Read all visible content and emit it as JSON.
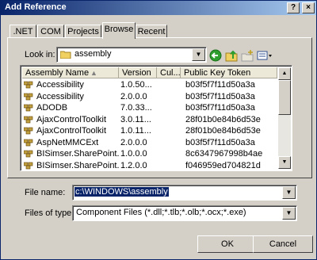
{
  "window": {
    "title": "Add Reference",
    "help_glyph": "?",
    "close_glyph": "×"
  },
  "tabs": [
    {
      "label": ".NET"
    },
    {
      "label": "COM"
    },
    {
      "label": "Projects"
    },
    {
      "label": "Browse"
    },
    {
      "label": "Recent"
    }
  ],
  "browse": {
    "look_in_label": "Look in:",
    "look_in_value": "assembly",
    "toolbar_icons": [
      "back-icon",
      "up-folder-icon",
      "new-folder-icon",
      "views-menu-icon"
    ]
  },
  "list": {
    "columns": [
      "Assembly Name",
      "Version",
      "Cul...",
      "Public Key Token"
    ],
    "rows": [
      {
        "name": "Accessibility",
        "version": "1.0.50...",
        "culture": "",
        "token": "b03f5f7f11d50a3a"
      },
      {
        "name": "Accessibility",
        "version": "2.0.0.0",
        "culture": "",
        "token": "b03f5f7f11d50a3a"
      },
      {
        "name": "ADODB",
        "version": "7.0.33...",
        "culture": "",
        "token": "b03f5f7f11d50a3a"
      },
      {
        "name": "AjaxControlToolkit",
        "version": "3.0.11...",
        "culture": "",
        "token": "28f01b0e84b6d53e"
      },
      {
        "name": "AjaxControlToolkit",
        "version": "1.0.11...",
        "culture": "",
        "token": "28f01b0e84b6d53e"
      },
      {
        "name": "AspNetMMCExt",
        "version": "2.0.0.0",
        "culture": "",
        "token": "b03f5f7f11d50a3a"
      },
      {
        "name": "BISimser.SharePoint....",
        "version": "1.0.0.0",
        "culture": "",
        "token": "8c6347967998b4ae"
      },
      {
        "name": "BISimser.SharePoint....",
        "version": "1.2.0.0",
        "culture": "",
        "token": "f046959ed704821d"
      }
    ]
  },
  "file_name": {
    "label": "File name:",
    "value": "c:\\WINDOWS\\assembly"
  },
  "file_type": {
    "label": "Files of type:",
    "value": "Component Files (*.dll;*.tlb;*.olb;*.ocx;*.exe)"
  },
  "buttons": {
    "ok": "OK",
    "cancel": "Cancel"
  },
  "colors": {
    "title_start": "#0a246a",
    "title_end": "#a6caf0",
    "selection": "#0a246a",
    "face": "#d4d0c8",
    "go_green": "#2e9e2e"
  }
}
